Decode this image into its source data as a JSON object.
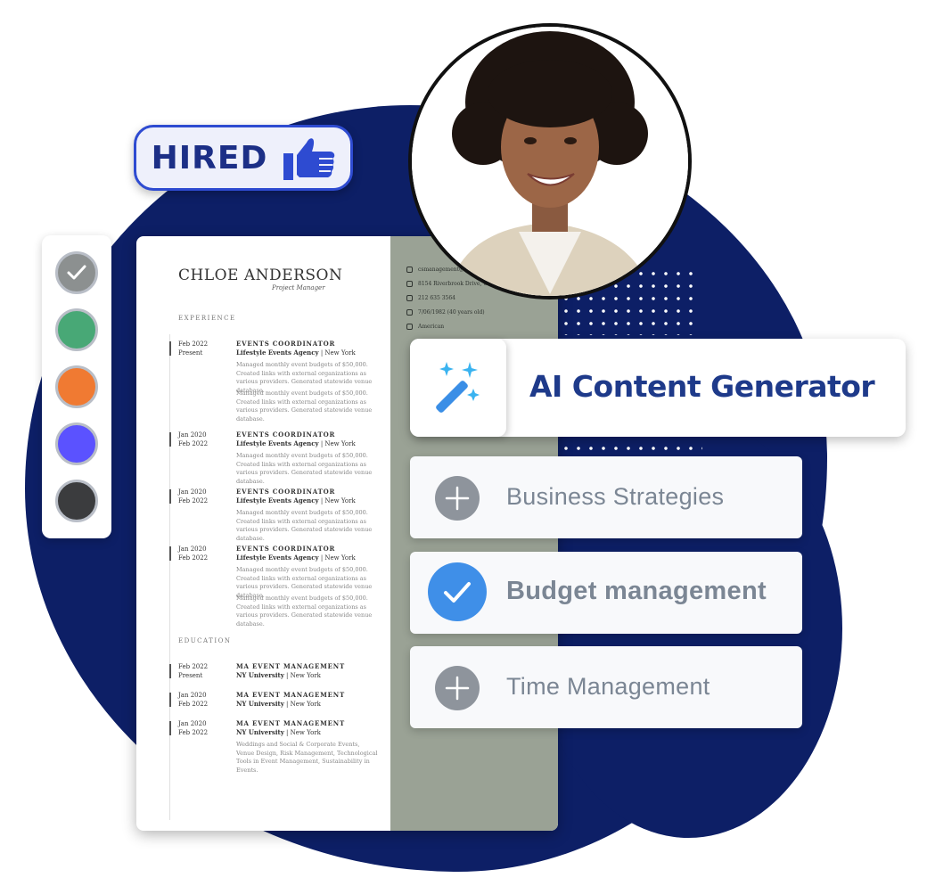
{
  "badge": {
    "label": "HIRED",
    "icon": "thumbs-up-icon"
  },
  "palette": {
    "swatches": [
      {
        "color": "#8c9090",
        "selected": true
      },
      {
        "color": "#48a876",
        "selected": false
      },
      {
        "color": "#f07a32",
        "selected": false
      },
      {
        "color": "#5b52ff",
        "selected": false
      },
      {
        "color": "#3b3c3e",
        "selected": false
      }
    ]
  },
  "resume": {
    "name": "CHLOE ANDERSON",
    "role": "Project Manager",
    "experience_heading": "EXPERIENCE",
    "education_heading": "EDUCATION",
    "experience": [
      {
        "dates": "Feb 2022\nPresent",
        "title": "EVENTS COORDINATOR",
        "company": "Lifestyle Events Agency",
        "location": " | New York",
        "bullets": [
          "Managed monthly event budgets of $50,000. Created links with external organizations as various providers. Generated statewide venue database.",
          "Managed monthly event budgets of $50,000. Created links with external organizations as various providers. Generated statewide venue database."
        ]
      },
      {
        "dates": "Jan 2020\nFeb 2022",
        "title": "EVENTS COORDINATOR",
        "company": "Lifestyle Events Agency",
        "location": " | New York",
        "bullets": [
          "Managed monthly event budgets of $50,000. Created links with external organizations as various providers. Generated statewide venue database."
        ]
      },
      {
        "dates": "Jan 2020\nFeb 2022",
        "title": "EVENTS COORDINATOR",
        "company": "Lifestyle Events Agency",
        "location": " | New York",
        "bullets": [
          "Managed monthly event budgets of $50,000. Created links with external organizations as various providers. Generated statewide venue database."
        ]
      },
      {
        "dates": "Jan 2020\nFeb 2022",
        "title": "EVENTS COORDINATOR",
        "company": "Lifestyle Events Agency",
        "location": " | New York",
        "bullets": [
          "Managed monthly event budgets of $50,000. Created links with external organizations as various providers. Generated statewide venue database.",
          "Managed monthly event budgets of $50,000. Created links with external organizations as various providers. Generated statewide venue database."
        ]
      }
    ],
    "education": [
      {
        "dates": "Feb 2022\nPresent",
        "title": "MA EVENT MANAGEMENT",
        "company": "NY University",
        "location": " | New York",
        "bullets": []
      },
      {
        "dates": "Jan 2020\nFeb 2022",
        "title": "MA EVENT MANAGEMENT",
        "company": "NY University",
        "location": " | New York",
        "bullets": []
      },
      {
        "dates": "Jan 2020\nFeb 2022",
        "title": "MA EVENT MANAGEMENT",
        "company": "NY University",
        "location": " | New York",
        "bullets": [
          "Weddings and Social & Corporate Events, Venue Design, Risk Management, Technological Tools in Event Management, Sustainability in Events."
        ]
      }
    ],
    "contact": [
      {
        "icon": "mail-icon",
        "text": "csmanagement@"
      },
      {
        "icon": "home-icon",
        "text": "8154 Riverbrook Drive, US"
      },
      {
        "icon": "phone-icon",
        "text": "212 635 3564"
      },
      {
        "icon": "calendar-icon",
        "text": "7/06/1982 (40 years old)"
      },
      {
        "icon": "globe-icon",
        "text": "American"
      }
    ]
  },
  "ai_card": {
    "title": "AI Content Generator",
    "icon": "magic-wand-icon"
  },
  "options": [
    {
      "label": "Business Strategies",
      "checked": false,
      "icon": "plus-icon"
    },
    {
      "label": "Budget management",
      "checked": true,
      "icon": "check-icon"
    },
    {
      "label": "Time Management",
      "checked": false,
      "icon": "plus-icon"
    }
  ]
}
